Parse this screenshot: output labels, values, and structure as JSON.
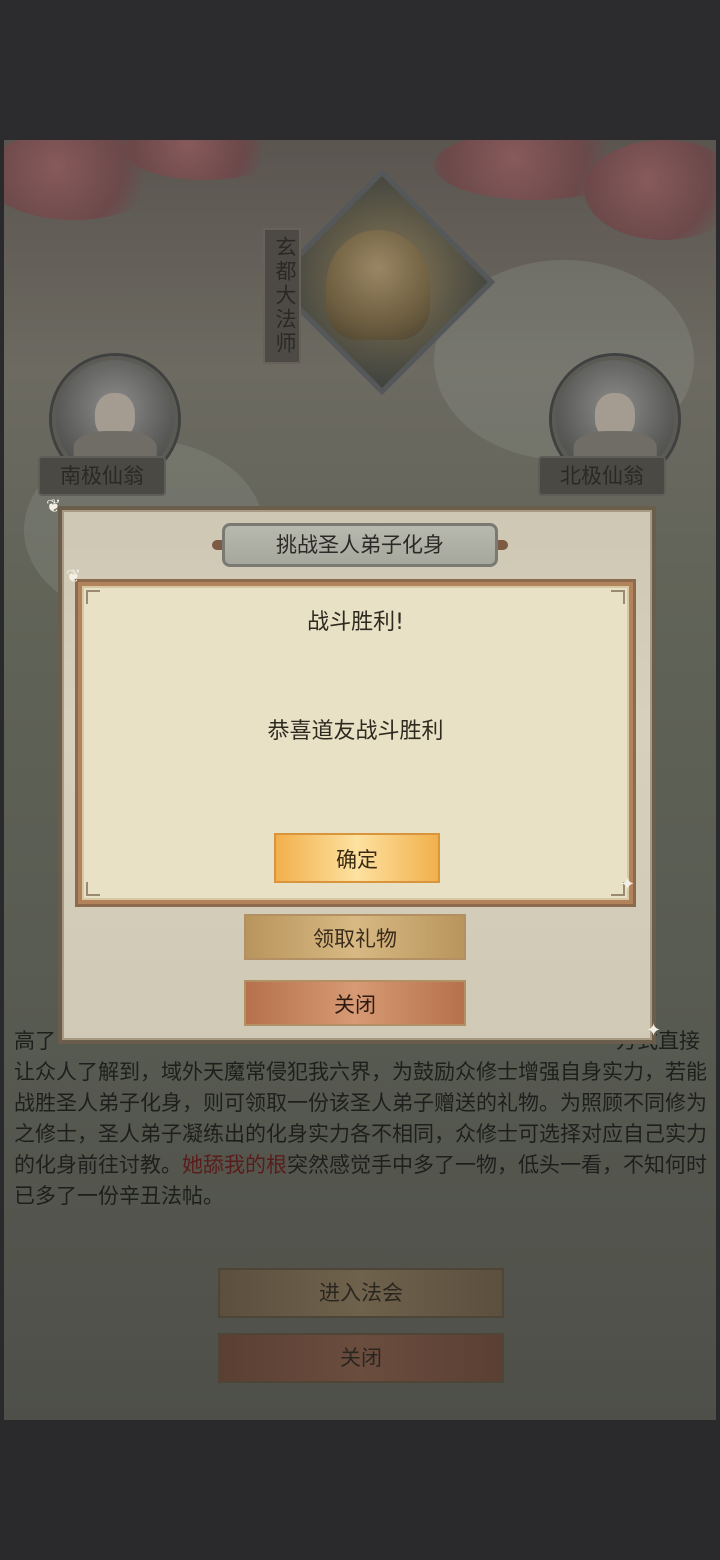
{
  "scene": {
    "main_figure_name": "玄都大法师",
    "left_figure_name": "南极仙翁",
    "right_figure_name": "北极仙翁",
    "story_text_prefix": "高了",
    "story_text_suffix": "方式直接让众人了解到，域外天魔常侵犯我六界，为鼓励众修士增强自身实力，若能战胜圣人弟子化身，则可领取一份该圣人弟子赠送的礼物。为照顾不同修为之修士，圣人弟子凝练出的化身实力各不相同，众修士可选择对应自己实力的化身前往讨教。",
    "story_text_highlight": "她舔我的根",
    "story_text_end": "突然感觉手中多了一物，低头一看，不知何时已多了一份辛丑法帖。",
    "enter_button": "进入法会",
    "close_button": "关闭"
  },
  "panel": {
    "title": "挑战圣人弟子化身",
    "gift_button": "领取礼物",
    "close_button": "关闭"
  },
  "dialog": {
    "title": "战斗胜利!",
    "message": "恭喜道友战斗胜利",
    "confirm_button": "确定"
  }
}
